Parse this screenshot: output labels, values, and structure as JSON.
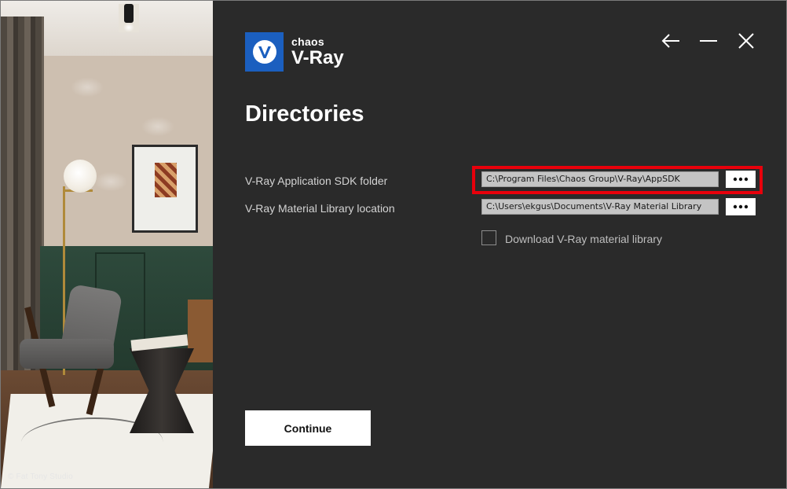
{
  "hero": {
    "credit": "© Fat Tony Studio"
  },
  "logo": {
    "brand": "chaos",
    "product": "V-Ray",
    "icon": "vray-logo-icon"
  },
  "window_controls": {
    "back_icon": "arrow-left-icon",
    "minimize_icon": "minimize-icon",
    "close_icon": "close-icon"
  },
  "page": {
    "title": "Directories"
  },
  "fields": [
    {
      "label": "V-Ray Application SDK folder",
      "value": "C:\\Program Files\\Chaos Group\\V-Ray\\AppSDK",
      "browse_icon": "more-dots-icon"
    },
    {
      "label": "V-Ray Material Library location",
      "value": "C:\\Users\\ekgus\\Documents\\V-Ray Material Library",
      "browse_icon": "more-dots-icon"
    }
  ],
  "download_option": {
    "label": "Download V-Ray material library",
    "checked": false
  },
  "actions": {
    "continue_label": "Continue"
  },
  "colors": {
    "background": "#2a2a2a",
    "accent": "#1b5fbf",
    "highlight": "#e8000b"
  }
}
